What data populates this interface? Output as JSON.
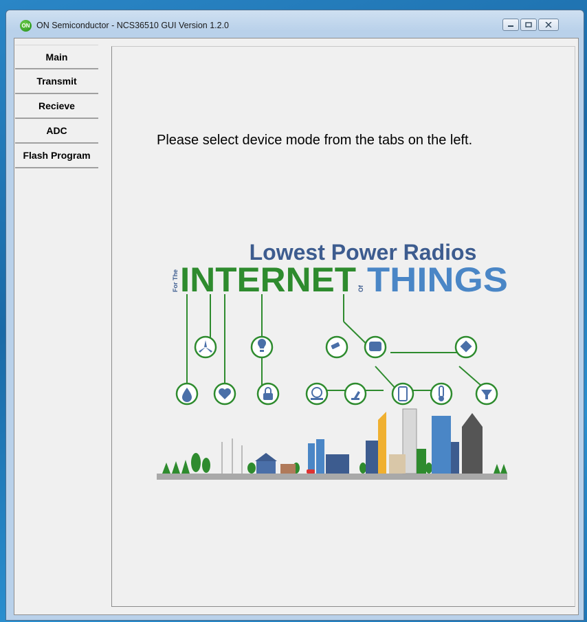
{
  "window": {
    "title": "ON Semiconductor - NCS36510 GUI Version 1.2.0",
    "icon_text": "ON"
  },
  "tabs": [
    {
      "label": "Main"
    },
    {
      "label": "Transmit"
    },
    {
      "label": "Recieve"
    },
    {
      "label": "ADC"
    },
    {
      "label": "Flash Program"
    }
  ],
  "main": {
    "message": "Please select device mode from the tabs on the left."
  },
  "banner": {
    "headline": "Lowest Power Radios",
    "for_the": "For The",
    "internet": "INTERNET",
    "of": "Of",
    "things": "THINGS"
  },
  "colors": {
    "headline": "#3d5c8f",
    "internet": "#2e8b2e",
    "things": "#4a86c6",
    "node": "#2e8b2e"
  }
}
